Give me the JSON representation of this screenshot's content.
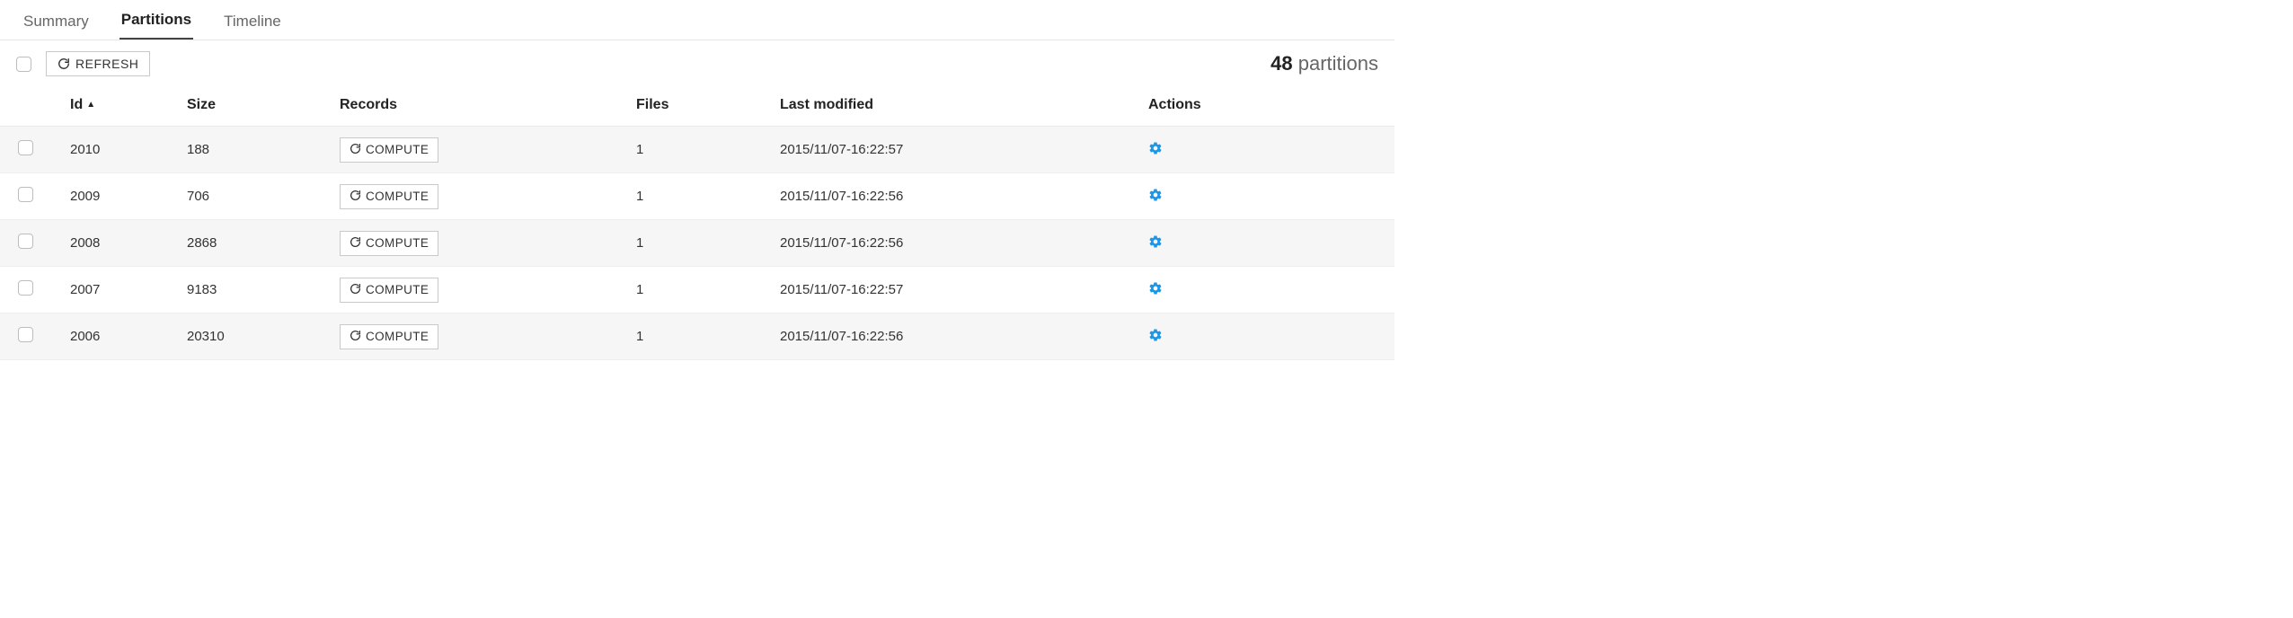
{
  "tabs": {
    "summary": "Summary",
    "partitions": "Partitions",
    "timeline": "Timeline"
  },
  "toolbar": {
    "refresh_label": "REFRESH",
    "count_number": "48",
    "count_label": "partitions"
  },
  "table": {
    "headers": {
      "id": "Id",
      "size": "Size",
      "records": "Records",
      "files": "Files",
      "last_modified": "Last modified",
      "actions": "Actions"
    },
    "compute_label": "COMPUTE",
    "rows": [
      {
        "id": "2010",
        "size": "188",
        "files": "1",
        "last_modified": "2015/11/07-16:22:57"
      },
      {
        "id": "2009",
        "size": "706",
        "files": "1",
        "last_modified": "2015/11/07-16:22:56"
      },
      {
        "id": "2008",
        "size": "2868",
        "files": "1",
        "last_modified": "2015/11/07-16:22:56"
      },
      {
        "id": "2007",
        "size": "9183",
        "files": "1",
        "last_modified": "2015/11/07-16:22:57"
      },
      {
        "id": "2006",
        "size": "20310",
        "files": "1",
        "last_modified": "2015/11/07-16:22:56"
      }
    ]
  }
}
